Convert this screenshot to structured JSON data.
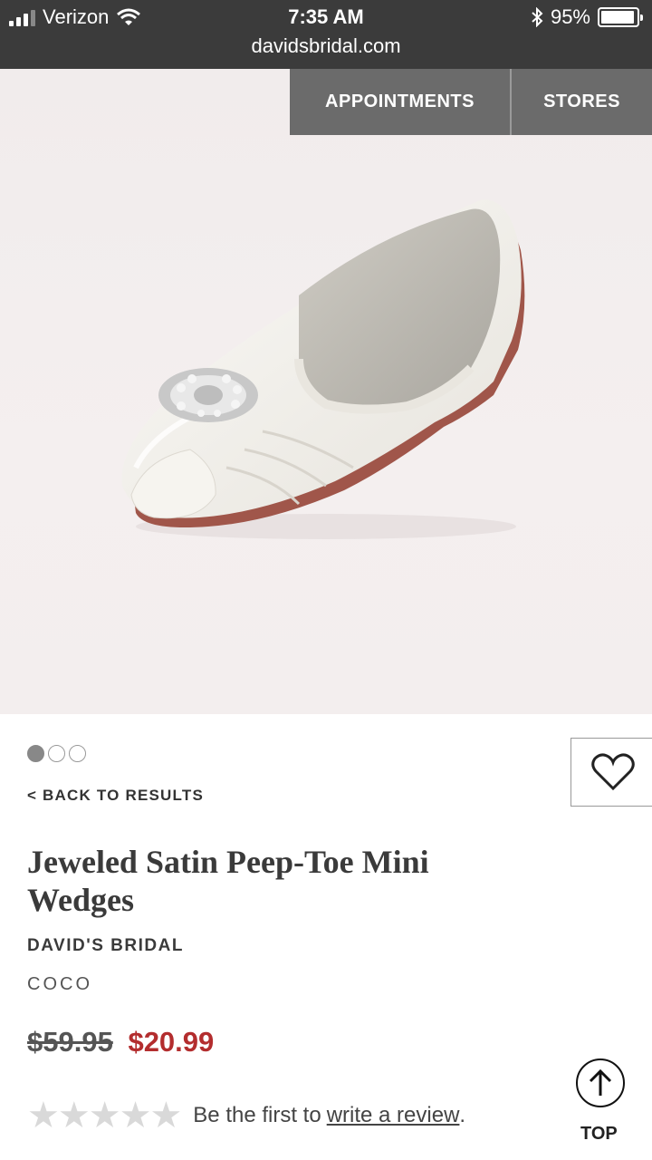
{
  "status_bar": {
    "carrier": "Verizon",
    "time": "7:35 AM",
    "battery": "95%",
    "url": "davidsbridal.com"
  },
  "nav": {
    "appointments": "APPOINTMENTS",
    "stores": "STORES"
  },
  "gallery": {
    "image_count": 3,
    "active_index": 0
  },
  "product": {
    "back_link": "< BACK TO RESULTS",
    "title": "Jeweled Satin Peep-Toe Mini Wedges",
    "brand": "DAVID'S BRIDAL",
    "color": "COCO",
    "original_price": "$59.95",
    "sale_price": "$20.99",
    "rating_stars": 0,
    "review_prefix": "Be the first to",
    "review_link": "write a review",
    "review_suffix": "."
  },
  "top_button": {
    "label": "TOP"
  },
  "colors": {
    "sale": "#b32d2e",
    "nav_bg": "#6b6b6b",
    "status_bg": "#3b3b3b"
  }
}
